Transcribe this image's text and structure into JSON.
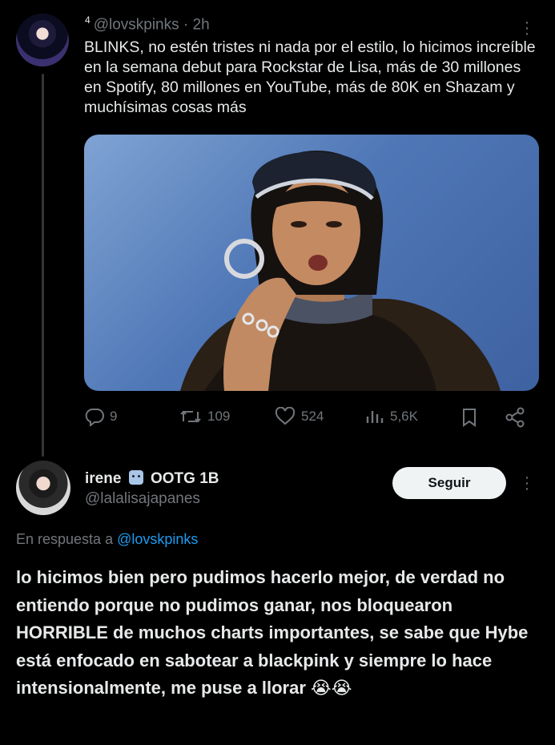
{
  "tweet1": {
    "reply_count_sup": "4",
    "handle": "@lovskpinks",
    "time": "· 2h",
    "text": "BLINKS, no estén tristes ni nada por el estilo, lo hicimos increíble en la semana debut para Rockstar de Lisa, más de 30 millones en Spotify, 80 millones en YouTube, más de 80K en Shazam y muchísimas cosas más",
    "actions": {
      "replies": "9",
      "retweets": "109",
      "likes": "524",
      "views": "5,6K"
    }
  },
  "tweet2": {
    "name": "irene",
    "badge_text": "OOTG 1B",
    "handle": "@lalalisajapanes",
    "follow_label": "Seguir",
    "reply_prefix": "En respuesta a",
    "reply_handle": "@lovskpinks",
    "text": "lo hicimos bien pero pudimos hacerlo mejor, de verdad no entiendo porque no pudimos ganar, nos bloquearon HORRIBLE de muchos charts importantes, se sabe que Hybe está enfocado en sabotear a blackpink y siempre lo hace intensionalmente, me puse a llorar 😭😭"
  },
  "colors": {
    "background": "#000000",
    "text_primary": "#e7e9ea",
    "text_secondary": "#71767b",
    "link": "#1d9bf0",
    "follow_bg": "#eff3f4"
  },
  "icons": [
    "avatar",
    "more-options-icon",
    "reply-icon",
    "retweet-icon",
    "like-icon",
    "views-icon",
    "bookmark-icon",
    "share-icon",
    "robot-emoji-icon"
  ]
}
